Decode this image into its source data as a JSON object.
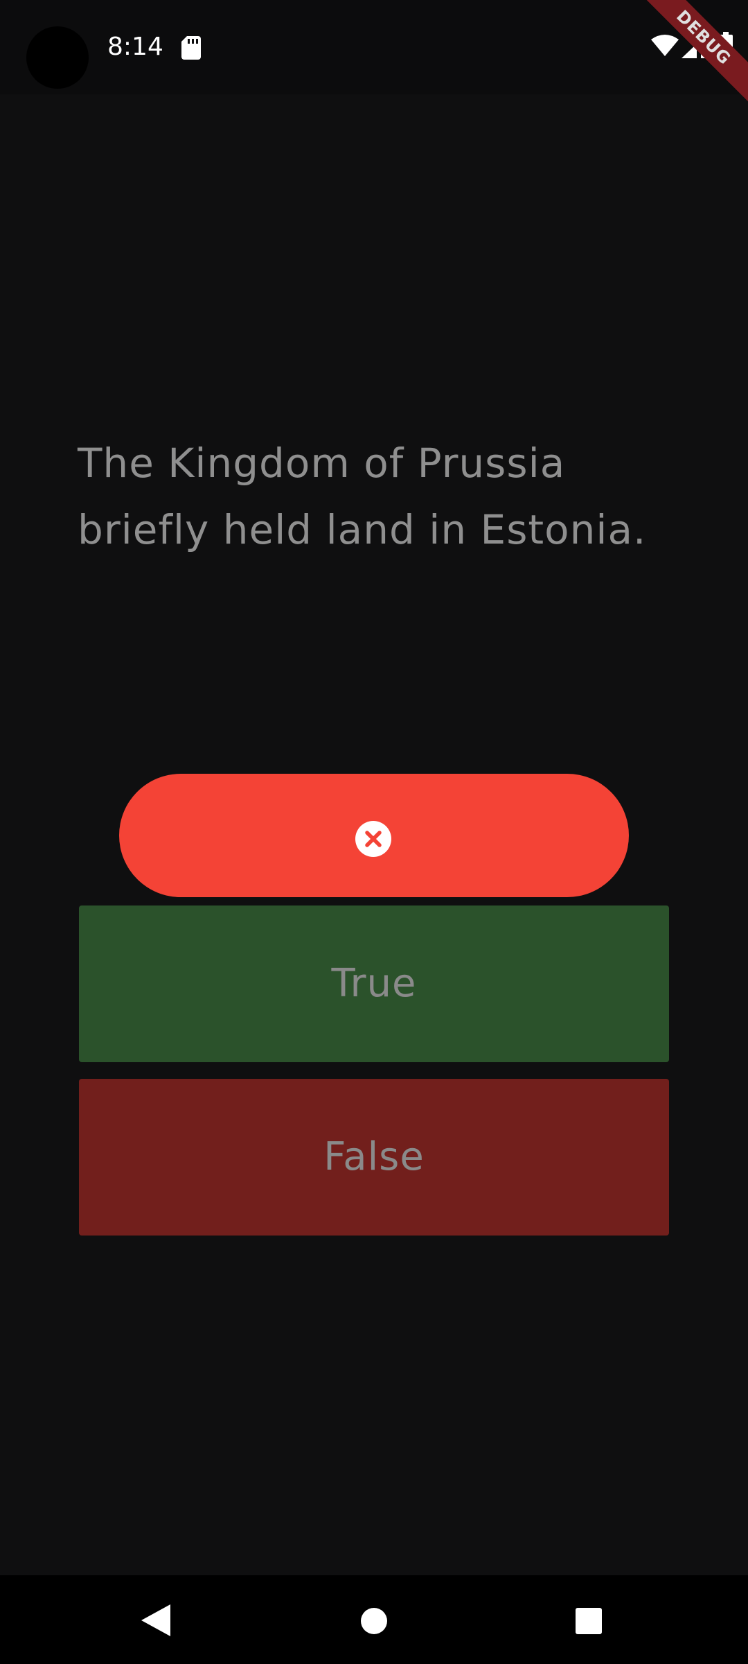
{
  "status_bar": {
    "time": "8:14",
    "icons": [
      "sd-card-icon",
      "wifi-icon",
      "cellular-signal-icon",
      "battery-icon"
    ]
  },
  "debug_banner": {
    "label": "DEBUG",
    "color": "#7a1b1f"
  },
  "question": {
    "text": "The Kingdom of Prussia briefly held land in Estonia."
  },
  "result": {
    "icon": "close-circle-icon",
    "color": "#f44336"
  },
  "answers": {
    "true_label": "True",
    "true_color": "#2b522b",
    "false_label": "False",
    "false_color": "#721f1c"
  },
  "navigation": {
    "icons": [
      "back-icon",
      "home-icon",
      "recents-icon"
    ]
  }
}
